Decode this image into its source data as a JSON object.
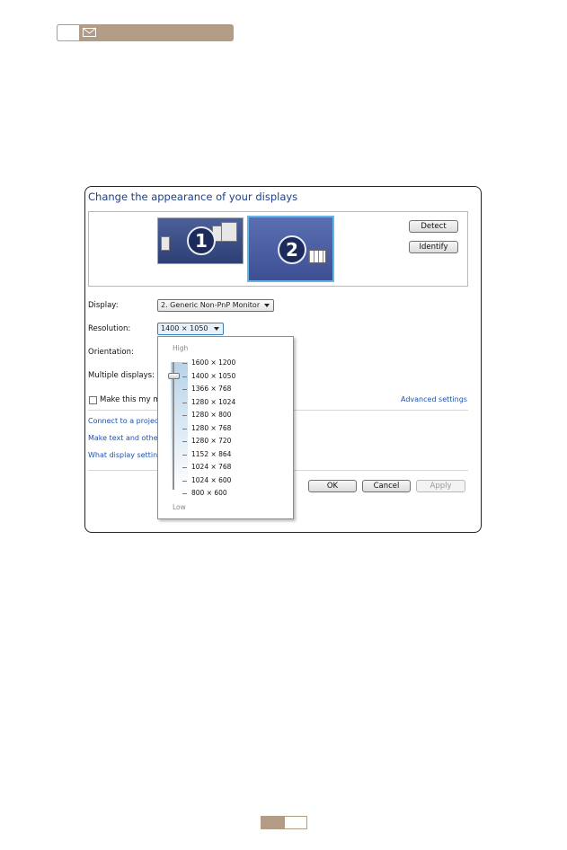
{
  "panel": {
    "title": "Change the appearance of your displays",
    "monitors": [
      {
        "number": "1",
        "selected": false
      },
      {
        "number": "2",
        "selected": true
      }
    ],
    "detect_label": "Detect",
    "identify_label": "Identify",
    "display_label": "Display:",
    "display_value": "2. Generic Non-PnP Monitor",
    "resolution_label": "Resolution:",
    "resolution_value": "1400 × 1050",
    "orientation_label": "Orientation:",
    "multiple_displays_label": "Multiple displays:",
    "checkbox_label": "Make this my ma",
    "advanced_settings": "Advanced settings",
    "links": [
      "Connect to a projec",
      "Make text and other",
      "What display settin"
    ],
    "ok_label": "OK",
    "cancel_label": "Cancel",
    "apply_label": "Apply"
  },
  "resolution_popup": {
    "high_label": "High",
    "low_label": "Low",
    "options": [
      "1600 × 1200",
      "1400 × 1050",
      "1366 × 768",
      "1280 × 1024",
      "1280 × 800",
      "1280 × 768",
      "1280 × 720",
      "1152 × 864",
      "1024 × 768",
      "1024 × 600",
      "800 × 600"
    ],
    "selected_index": 1
  },
  "colors": {
    "accent": "#b29c86",
    "title_blue": "#1c3f8c",
    "link_blue": "#1c52b3",
    "selection_border": "#62b6ec"
  },
  "icons": {
    "header": "mail-icon"
  }
}
